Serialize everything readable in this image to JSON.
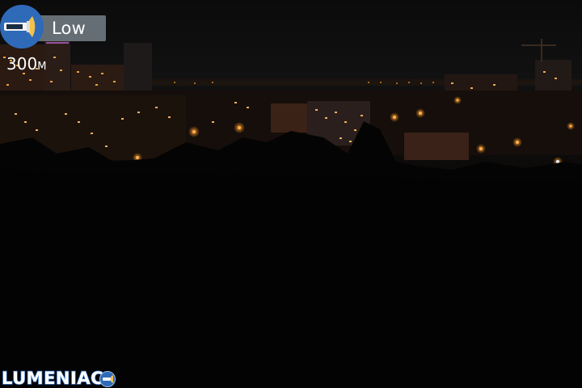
{
  "hud": {
    "mode_label": "Low",
    "distance_value": "300",
    "distance_unit": "M"
  },
  "brand": {
    "name": "LUMENIAC"
  },
  "icons": {
    "mode": "flashlight-icon",
    "brand": "flashlight-badge-icon"
  },
  "colors": {
    "accent_blue": "#2f6ab8",
    "beam_yellow": "#f2c24a",
    "pill_gray": "#7a848c",
    "city_lights": "#ff9a2a"
  }
}
